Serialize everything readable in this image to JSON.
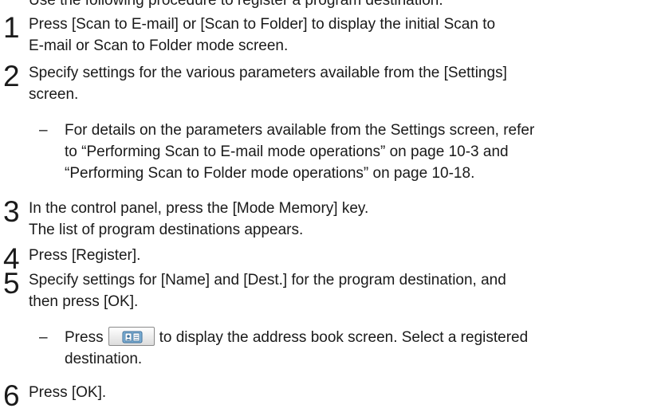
{
  "top_partial": "Use the following procedure to register a program destination.",
  "steps": [
    {
      "number": "1",
      "lines": [
        "Press [Scan to E-mail] or [Scan to Folder] to display the initial Scan to",
        "E-mail or Scan to Folder mode screen."
      ]
    },
    {
      "number": "2",
      "lines": [
        "Specify settings for the various parameters available from the [Settings]",
        "screen."
      ]
    },
    {
      "number": "3",
      "lines": [
        "In the control panel, press the [Mode Memory] key.",
        "The list of program destinations appears."
      ]
    },
    {
      "number": "4",
      "lines": [
        "Press [Register]."
      ]
    },
    {
      "number": "5",
      "lines": [
        "Specify settings for [Name] and [Dest.] for the program destination, and",
        "then press [OK]."
      ]
    },
    {
      "number": "6",
      "lines": [
        "Press [OK]."
      ]
    }
  ],
  "notes": {
    "step2": {
      "dash": "–",
      "lines": [
        "For details on the parameters available from the Settings screen, refer",
        "to “Performing Scan to E-mail mode operations” on page 10-3 and",
        "“Performing Scan to Folder mode operations” on page 10-18."
      ]
    },
    "step5": {
      "dash": "–",
      "before_icon": "Press",
      "after_icon": "to display the address book screen. Select a registered",
      "line2": "destination.",
      "icon": "address-book-icon"
    }
  }
}
